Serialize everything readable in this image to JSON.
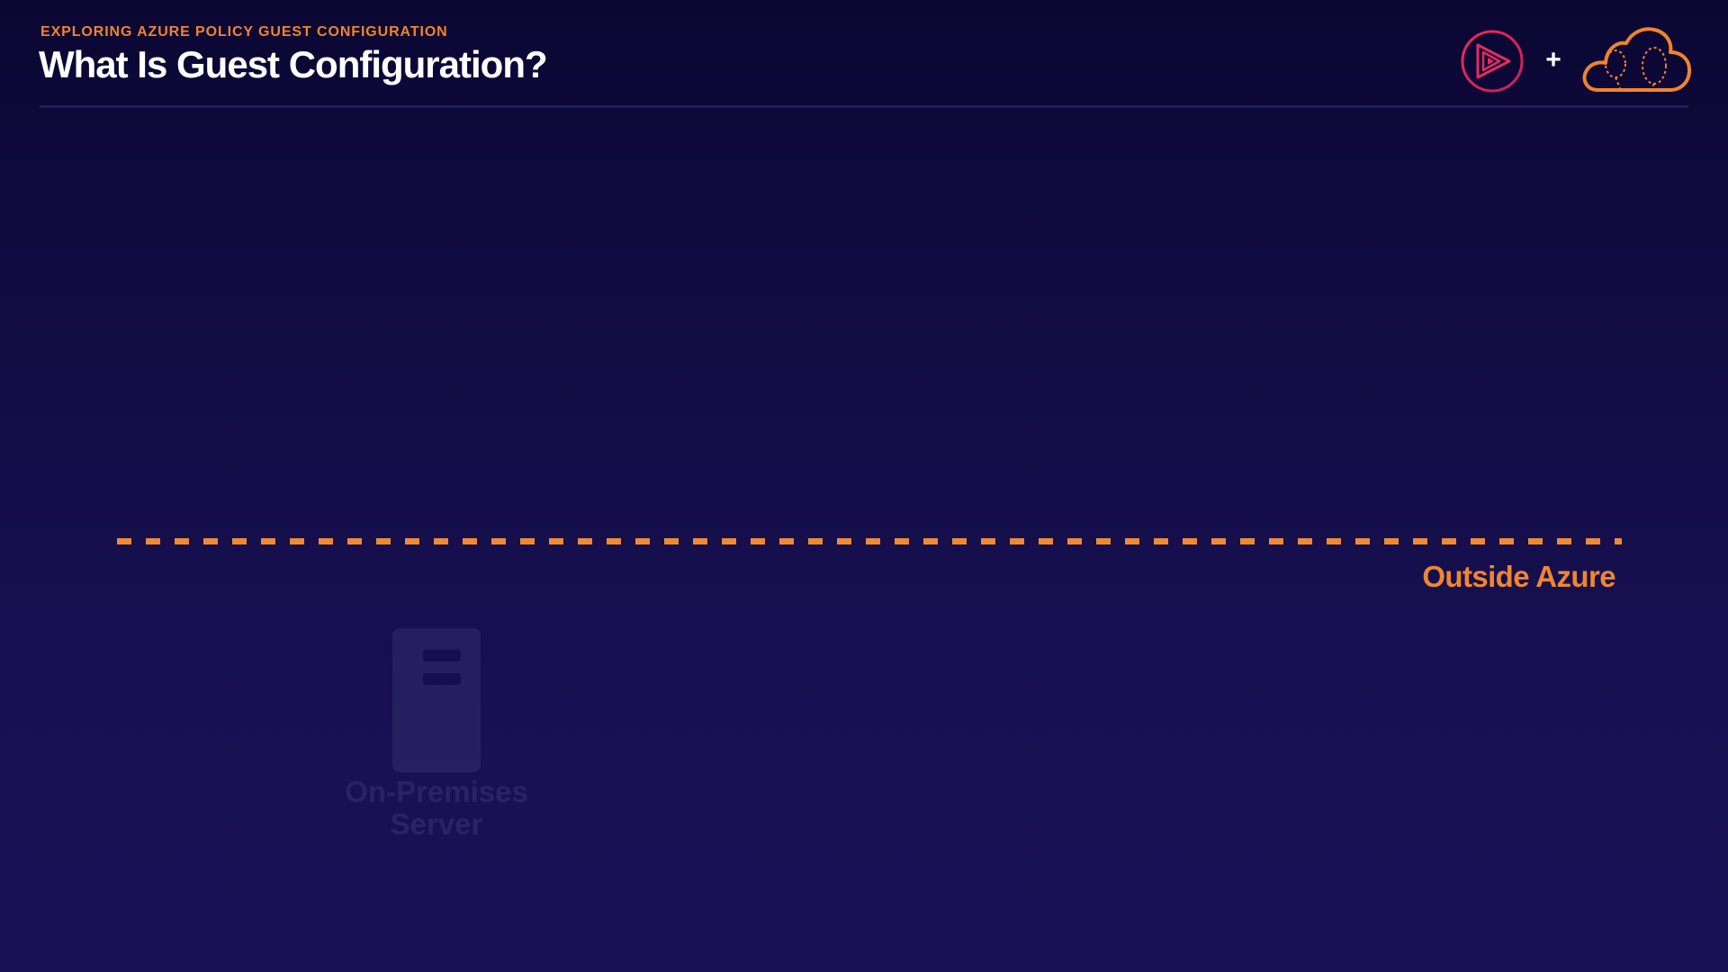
{
  "header": {
    "kicker": "EXPLORING AZURE POLICY GUEST CONFIGURATION",
    "title": "What Is Guest Configuration?",
    "plus": "+"
  },
  "diagram": {
    "boundary_label": "Outside Azure",
    "server_label_line1": "On-Premises",
    "server_label_line2": "Server"
  },
  "icons": {
    "logo_left": "play-circle-icon",
    "logo_right": "cloud-balloon-icon"
  },
  "colors": {
    "accent_orange": "#f0842c",
    "logo_pink": "#e42b5f",
    "background_top": "#0b0733",
    "background_bottom": "#1a1257"
  }
}
